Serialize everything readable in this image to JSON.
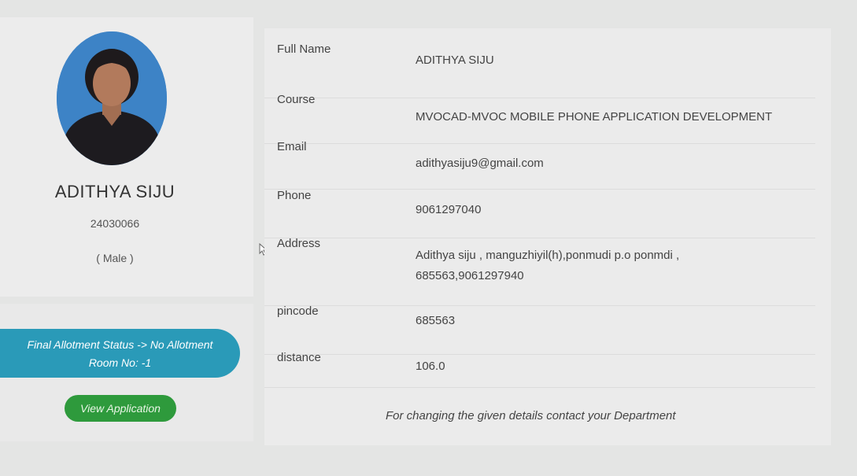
{
  "profile": {
    "name": "ADITHYA SIJU",
    "id": "24030066",
    "gender": "( Male )",
    "photo_icon": "user-photo"
  },
  "status": {
    "allotment": "Final Allotment Status -> No Allotment",
    "room": "Room No: -1",
    "color": "#2a9ab8"
  },
  "actions": {
    "view_application": "View Application",
    "color": "#2e9a3c"
  },
  "details": {
    "full_name_label": "Full Name",
    "full_name": "ADITHYA SIJU",
    "course_label": "Course",
    "course": "MVOCAD-MVOC MOBILE PHONE APPLICATION DEVELOPMENT",
    "email_label": "Email",
    "email": "adithyasiju9@gmail.com",
    "phone_label": "Phone",
    "phone": "9061297040",
    "address_label": "Address",
    "address_line1": "Adithya siju , manguzhiyil(h),ponmudi p.o ponmdi ,",
    "address_line2": "685563,9061297940",
    "pincode_label": "pincode",
    "pincode": "685563",
    "distance_label": "distance",
    "distance": "106.0"
  },
  "footer_note": "For changing the given details contact your Department"
}
